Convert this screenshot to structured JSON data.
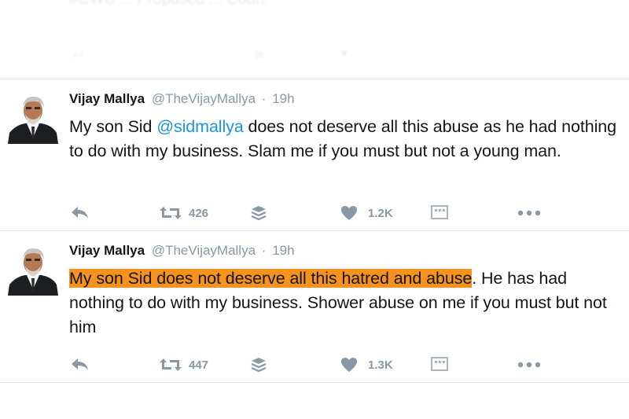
{
  "previous_tweet": {
    "text_fragment": "#CWC  ...  Proposed ... Court",
    "icons": [
      "reply-icon",
      "retweet-icon",
      "stack-icon",
      "like-icon"
    ]
  },
  "tweets": [
    {
      "author": {
        "name": "Vijay Mallya",
        "handle": "@TheVijayMallya",
        "separator": "·",
        "time": "19h"
      },
      "text": {
        "before": "My son Sid ",
        "mention": "@sidmallya",
        "after": " does not deserve all this abuse as he had nothing to do with my business. Slam me if you must but not a young man."
      },
      "actions": {
        "retweets": "426",
        "likes": "1.2K"
      },
      "icons": [
        "reply-icon",
        "retweet-icon",
        "stack-icon",
        "heart-icon",
        "analytics-icon",
        "more-dots-icon"
      ]
    },
    {
      "author": {
        "name": "Vijay Mallya",
        "handle": "@TheVijayMallya",
        "separator": "·",
        "time": "19h"
      },
      "text": {
        "highlighted": "My son Sid does not deserve all this hatred and abuse",
        "after": ". He has had nothing to do with my business. Shower abuse on me if you must but not him"
      },
      "actions": {
        "retweets": "447",
        "likes": "1.3K"
      },
      "icons": [
        "reply-icon",
        "retweet-icon",
        "stack-icon",
        "heart-icon",
        "analytics-icon",
        "more-dots-icon"
      ]
    }
  ],
  "colors": {
    "highlight": "#f6931e",
    "mention": "#1b95e0",
    "muted": "#8899a6",
    "divider": "#e1e8ed"
  }
}
